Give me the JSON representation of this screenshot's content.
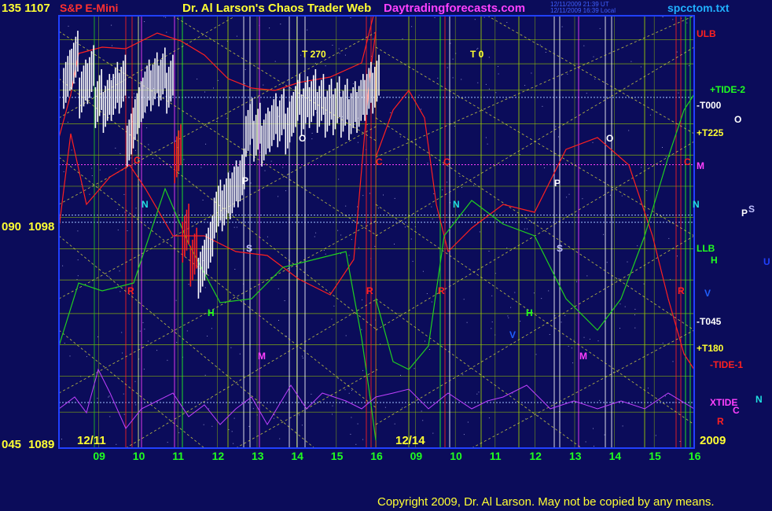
{
  "header": {
    "ylabel_top_left": "135 1107",
    "instrument": "S&P E-Mini",
    "title": "Dr. Al Larson's Chaos Trader Web",
    "site": "Daytradingforecasts.com",
    "timestamp_line1": "12/11/2009 21:39 UT",
    "timestamp_line2": "12/11/2009 16:39 Local",
    "filename": "spcctom.txt"
  },
  "footer": {
    "copyright": "Copyright 2009, Dr. Al Larson. May not be copied by any means."
  },
  "colors": {
    "background": "#0b0c5a",
    "frame": "#2040ff",
    "price_bar": "#ffffff",
    "price_bar_down": "#ff2020",
    "tide1": "#ff2020",
    "tide2": "#20d020",
    "xtide": "#c040ff",
    "gann": "#e0e040",
    "axis_text": "#ffff33"
  },
  "chart_data": {
    "type": "line",
    "title": "Dr. Al Larson's Chaos Trader Web",
    "y_axis": {
      "ticks": [
        {
          "angle": "135",
          "price": "1107",
          "value": 1107
        },
        {
          "angle": "090",
          "price": "1098",
          "value": 1098
        },
        {
          "angle": "045",
          "price": "1089",
          "value": 1089
        }
      ],
      "ylim": [
        1089,
        1107
      ]
    },
    "x_axis": {
      "day1_label": "12/11",
      "day2_label": "12/14",
      "year_label": "2009",
      "hour_ticks_day1": [
        "09",
        "10",
        "11",
        "12",
        "13",
        "14",
        "15",
        "16"
      ],
      "hour_ticks_day2": [
        "09",
        "10",
        "11",
        "12",
        "13",
        "14",
        "15",
        "16"
      ]
    },
    "series_prices": {
      "name": "S&P E-Mini",
      "x_hours": [
        8.2,
        8.4,
        8.6,
        8.8,
        9.0,
        9.2,
        9.4,
        9.6,
        9.8,
        10.0,
        10.2,
        10.4,
        10.6,
        10.8,
        11.0,
        11.2,
        11.4,
        11.6,
        11.8,
        12.0,
        12.2,
        12.4,
        12.6,
        12.8,
        13.0,
        13.2,
        13.4,
        13.6,
        13.8,
        14.0,
        14.2,
        14.4,
        14.6,
        14.8,
        15.0,
        15.2,
        15.4,
        15.6,
        15.8,
        16.0
      ],
      "close": [
        1104.4,
        1105.2,
        1104.0,
        1104.6,
        1103.6,
        1103.4,
        1103.9,
        1104.2,
        1102.0,
        1103.1,
        1104.0,
        1104.3,
        1104.5,
        1104.2,
        1101.3,
        1098.0,
        1097.0,
        1096.5,
        1097.5,
        1099.0,
        1099.3,
        1099.8,
        1100.3,
        1102.4,
        1102.2,
        1102.0,
        1102.6,
        1102.8,
        1102.5,
        1103.4,
        1103.3,
        1103.6,
        1103.4,
        1103.2,
        1103.3,
        1103.2,
        1103.1,
        1103.4,
        1103.9,
        1104.2
      ]
    },
    "tide_curves": [
      {
        "name": "TIDE-1",
        "color": "#ff2020"
      },
      {
        "name": "TIDE-2",
        "color": "#20d020"
      },
      {
        "name": "XTIDE",
        "color": "#c040ff"
      }
    ],
    "right_labels": [
      {
        "text": "ULB",
        "color": "#ff2020"
      },
      {
        "text": "+TIDE-2",
        "color": "#20ff20"
      },
      {
        "text": "-T000",
        "color": "#ffffff"
      },
      {
        "text": "+T225",
        "color": "#ffff33"
      },
      {
        "text": "M",
        "color": "#ff40ff"
      },
      {
        "text": "LLB",
        "color": "#20ff20"
      },
      {
        "text": "-T045",
        "color": "#ffffff"
      },
      {
        "text": "+T180",
        "color": "#ffff33"
      },
      {
        "text": "-TIDE-1",
        "color": "#ff2020"
      },
      {
        "text": "XTIDE",
        "color": "#ff40ff"
      }
    ],
    "outside_planet_labels": [
      {
        "text": "O",
        "color": "#ffffff"
      },
      {
        "text": "P",
        "color": "#ffffff"
      },
      {
        "text": "S",
        "color": "#c0c0ff"
      },
      {
        "text": "U",
        "color": "#2040ff"
      },
      {
        "text": "H",
        "color": "#20ff20"
      },
      {
        "text": "V",
        "color": "#2060ff"
      },
      {
        "text": "N",
        "color": "#20e0e0"
      },
      {
        "text": "C",
        "color": "#ff40ff"
      },
      {
        "text": "R",
        "color": "#ff2020"
      }
    ],
    "in_chart_labels": [
      {
        "text": "T 270",
        "color": "#ffff33"
      },
      {
        "text": "T 0",
        "color": "#ffff33"
      },
      {
        "text": "N",
        "color": "#20e0e0"
      },
      {
        "text": "R",
        "color": "#ff2020"
      },
      {
        "text": "H",
        "color": "#20ff20"
      },
      {
        "text": "M",
        "color": "#ff40ff"
      },
      {
        "text": "S",
        "color": "#c0c0ff"
      },
      {
        "text": "P",
        "color": "#ffffff"
      },
      {
        "text": "O",
        "color": "#ffffff"
      },
      {
        "text": "V",
        "color": "#2060ff"
      },
      {
        "text": "C",
        "color": "#ff2020"
      }
    ]
  }
}
